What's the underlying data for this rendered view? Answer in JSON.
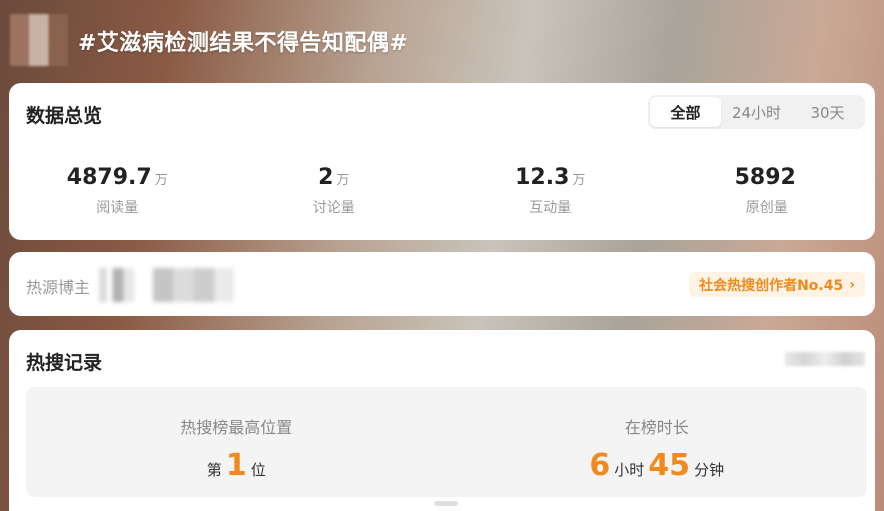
{
  "topic": {
    "title": "#艾滋病检测结果不得告知配偶#"
  },
  "overview": {
    "title": "数据总览",
    "tabs": [
      {
        "label": "全部",
        "active": true
      },
      {
        "label": "24小时",
        "active": false
      },
      {
        "label": "30天",
        "active": false
      }
    ],
    "stats": [
      {
        "value": "4879.7",
        "unit": "万",
        "label": "阅读量"
      },
      {
        "value": "2",
        "unit": "万",
        "label": "讨论量"
      },
      {
        "value": "12.3",
        "unit": "万",
        "label": "互动量"
      },
      {
        "value": "5892",
        "unit": "",
        "label": "原创量"
      }
    ]
  },
  "source": {
    "label": "热源博主",
    "badge": "社会热搜创作者No.45",
    "badge_chevron": "›"
  },
  "hot_record": {
    "title": "热搜记录",
    "top_position": {
      "label": "热搜榜最高位置",
      "prefix": "第",
      "value": "1",
      "suffix": "位"
    },
    "duration": {
      "label": "在榜时长",
      "hours": "6",
      "hours_unit": "小时",
      "minutes": "45",
      "minutes_unit": "分钟"
    }
  },
  "colors": {
    "accent": "#f08a1c",
    "badge_bg": "#fff3e6"
  }
}
